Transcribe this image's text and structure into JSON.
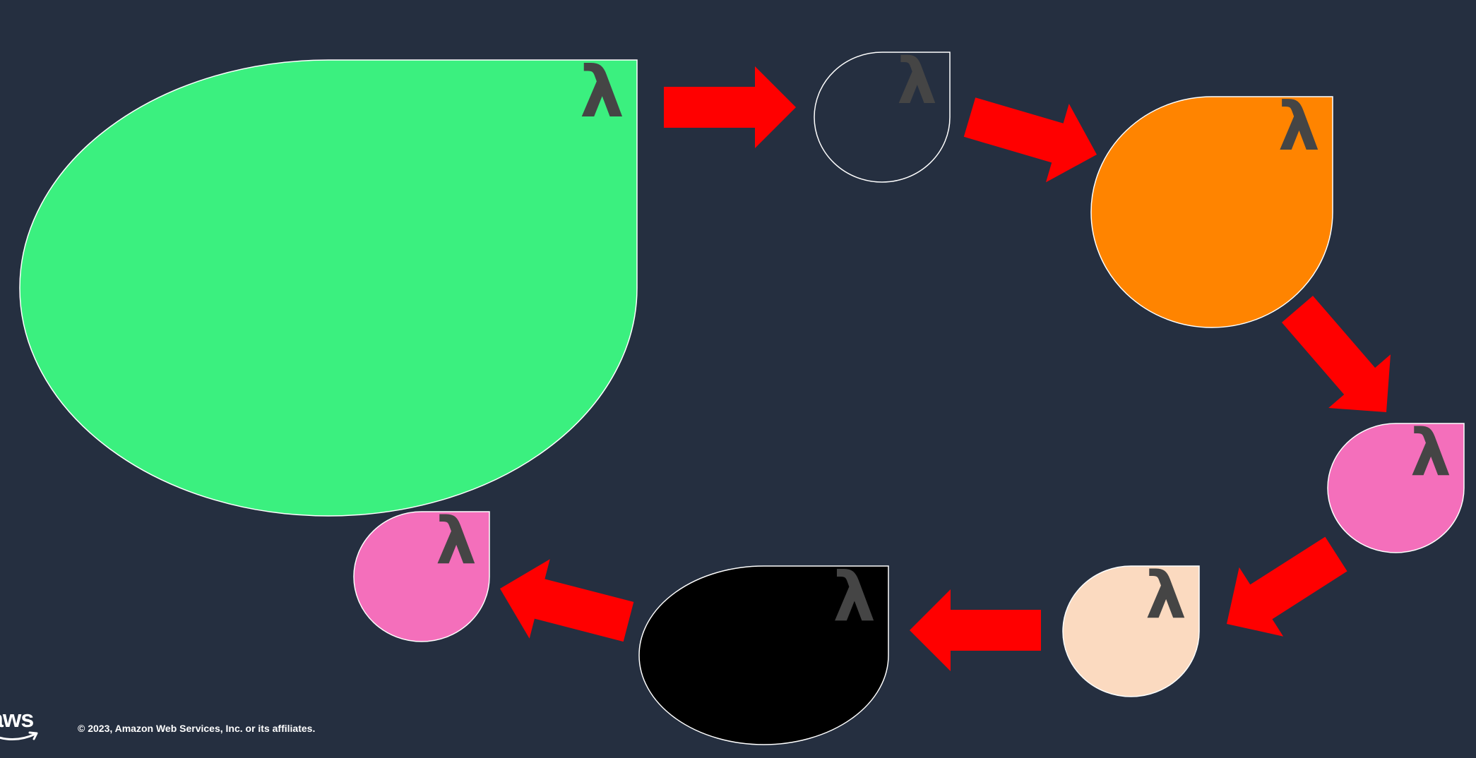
{
  "nodes": [
    {
      "name": "node-green",
      "fill": "#3bf07f",
      "glyph": "λ"
    },
    {
      "name": "node-outline",
      "fill": "none",
      "glyph": "λ"
    },
    {
      "name": "node-orange",
      "fill": "#ff8400",
      "glyph": "λ"
    },
    {
      "name": "node-pink-right",
      "fill": "#f46fbb",
      "glyph": "λ"
    },
    {
      "name": "node-peach",
      "fill": "#fbdac0",
      "glyph": "λ"
    },
    {
      "name": "node-black",
      "fill": "#000000",
      "glyph": "λ"
    },
    {
      "name": "node-pink-left",
      "fill": "#f46fbb",
      "glyph": "λ"
    }
  ],
  "arrow_color": "#ff0000",
  "background": "#252f40",
  "footer": {
    "logo": "aws",
    "copyright": "© 2023, Amazon Web Services, Inc. or its affiliates."
  }
}
